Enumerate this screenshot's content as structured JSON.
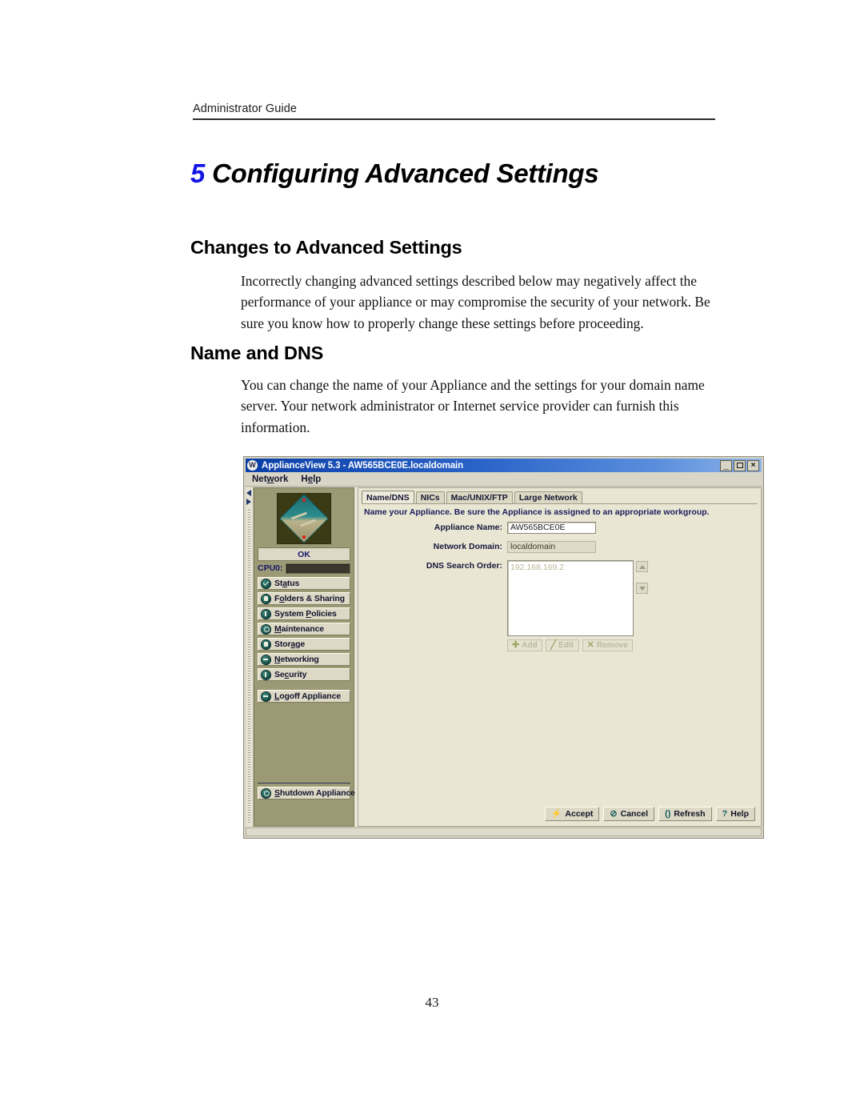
{
  "document": {
    "running_head": "Administrator Guide",
    "chapter_number": "5",
    "chapter_title": "Configuring Advanced Settings",
    "section_1_heading": "Changes to Advanced Settings",
    "section_1_body": "Incorrectly changing advanced settings described below may negatively affect the performance of your appliance or may compromise the security of your network.  Be sure you know how to properly change these settings before proceeding.",
    "section_2_heading": "Name and DNS",
    "section_2_body": "You can change the name of your Appliance and the settings for your domain name server.  Your network administrator or Internet service provider can furnish this information.",
    "page_number": "43"
  },
  "app": {
    "titlebar": {
      "app_icon_glyph": "W",
      "title": "ApplianceView 5.3 - AW565BCE0E.localdomain",
      "minimize_glyph": "_",
      "maximize_glyph": "",
      "close_glyph": "×"
    },
    "menubar": {
      "items": [
        {
          "prefix": "Net",
          "accel": "w",
          "suffix": "ork"
        },
        {
          "prefix": "H",
          "accel": "e",
          "suffix": "lp"
        }
      ]
    },
    "sidebar": {
      "status_label": "OK",
      "cpu_label": "CPU0:",
      "cpu_percent": 0,
      "nav_items": [
        {
          "label_pre": "St",
          "accel": "a",
          "label_post": "tus",
          "icon": "check-circle-icon",
          "name": "status"
        },
        {
          "label_pre": "F",
          "accel": "o",
          "label_post": "lders & Sharing",
          "icon": "folder-circle-icon",
          "name": "folders-sharing"
        },
        {
          "label_pre": "System ",
          "accel": "P",
          "label_post": "olicies",
          "icon": "exclamation-circle-icon",
          "name": "system-policies"
        },
        {
          "label_pre": "",
          "accel": "M",
          "label_post": "aintenance",
          "icon": "gear-circle-icon",
          "name": "maintenance"
        },
        {
          "label_pre": "Stor",
          "accel": "a",
          "label_post": "ge",
          "icon": "drive-circle-icon",
          "name": "storage"
        },
        {
          "label_pre": "",
          "accel": "N",
          "label_post": "etworking",
          "icon": "network-circle-icon",
          "name": "networking"
        },
        {
          "label_pre": "Se",
          "accel": "c",
          "label_post": "urity",
          "icon": "key-circle-icon",
          "name": "security"
        }
      ],
      "logoff": {
        "label_pre": "",
        "accel": "L",
        "label_post": "ogoff Appliance",
        "icon": "logoff-circle-icon"
      },
      "shutdown": {
        "label_pre": "",
        "accel": "S",
        "label_post": "hutdown Appliance",
        "icon": "power-circle-icon"
      }
    },
    "panel": {
      "tabs": [
        {
          "label": "Name/DNS",
          "active": true
        },
        {
          "label": "NICs",
          "active": false
        },
        {
          "label": "Mac/UNIX/FTP",
          "active": false
        },
        {
          "label": "Large Network",
          "active": false
        }
      ],
      "hint": "Name your Appliance. Be sure the Appliance is assigned to an appropriate workgroup.",
      "fields": {
        "appliance_name_label": "Appliance Name:",
        "appliance_name_value": "AW565BCE0E",
        "network_domain_label": "Network Domain:",
        "network_domain_value": "localdomain",
        "dns_search_order_label": "DNS Search Order:",
        "dns_search_order_value": "192.168.169.2"
      },
      "list_buttons": [
        {
          "label": "Add",
          "icon": "plus-icon",
          "glyph": "✚"
        },
        {
          "label": "Edit",
          "icon": "pencil-icon",
          "glyph": "╱"
        },
        {
          "label": "Remove",
          "icon": "x-icon",
          "glyph": "✕"
        }
      ],
      "spinner": {
        "up_glyph": "△",
        "down_glyph": "▽"
      },
      "actions": [
        {
          "label": "Accept",
          "icon": "lightning-icon",
          "glyph": "⚡"
        },
        {
          "label": "Cancel",
          "icon": "no-entry-icon",
          "glyph": "⊘"
        },
        {
          "label": "Refresh",
          "icon": "refresh-icon",
          "glyph": "()"
        },
        {
          "label": "Help",
          "icon": "question-icon",
          "glyph": "?"
        }
      ]
    }
  },
  "colors": {
    "chapter_number": "#1414e6",
    "titlebar_blue": "#0b3fa8",
    "sidebar_olive": "#9b9a74",
    "panel_bg": "#e9e7d4",
    "hint_text": "#1b1b5c"
  }
}
